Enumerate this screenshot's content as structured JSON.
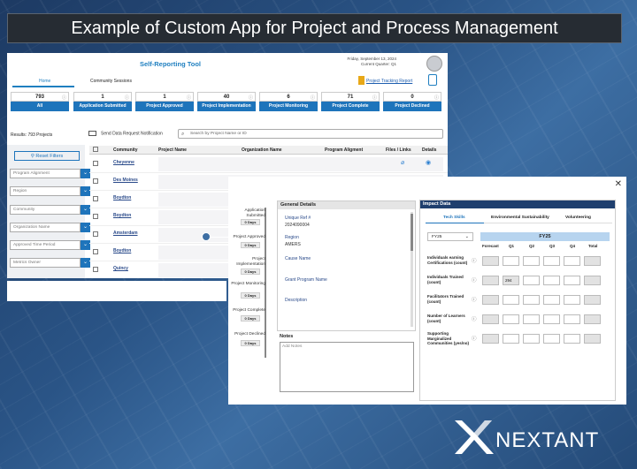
{
  "banner": {
    "title": "Example of Custom App for Project and Process Management"
  },
  "app": {
    "title": "Self-Reporting Tool",
    "date": "Friday, September 13, 2024",
    "quarter": "Current Quarter: Q1",
    "tabs": [
      "Home",
      "Community Sessions"
    ],
    "report_link": "Project Tracking Report"
  },
  "cards": [
    {
      "count": "793",
      "label": "All"
    },
    {
      "count": "1",
      "label": "Application Submitted"
    },
    {
      "count": "1",
      "label": "Project Approved"
    },
    {
      "count": "40",
      "label": "Project Implementation"
    },
    {
      "count": "6",
      "label": "Project Monitoring"
    },
    {
      "count": "71",
      "label": "Project Complete"
    },
    {
      "count": "0",
      "label": "Project Declined"
    }
  ],
  "results": "Results: 793 Projects",
  "send_notification": "Send Data Request Notification",
  "search": {
    "placeholder": "Search by Project Name or ID"
  },
  "reset_filters": "Reset Filters",
  "filters": [
    "Program Alignment",
    "Region",
    "Community",
    "Organization Name",
    "Approved Time Period",
    "Metrics Owner"
  ],
  "table": {
    "columns": [
      "Community",
      "Project Name",
      "Organization Name",
      "Program Aligment",
      "Files / Links",
      "Details"
    ],
    "rows": [
      "Cheyenne",
      "Des Moines",
      "Boydton",
      "Boydton",
      "Amsterdam",
      "Boydton",
      "Quincy"
    ]
  },
  "detail": {
    "steps": [
      {
        "label": "Application Submitted",
        "days": "0 Days"
      },
      {
        "label": "Project Approved",
        "days": "0 Days"
      },
      {
        "label": "Project Implementation",
        "days": "0 Days"
      },
      {
        "label": "Project Monitoring",
        "days": "0 Days"
      },
      {
        "label": "Project Complete",
        "days": "0 Days"
      },
      {
        "label": "Project Declined",
        "days": "0 Days"
      }
    ],
    "general": {
      "title": "General Details",
      "ref_label": "Unique Ref #",
      "ref_value": "2024090004",
      "region_label": "Region",
      "region_value": "AMERS",
      "cause_label": "Cause Name",
      "grant_label": "Grant Program Name",
      "desc_label": "Description"
    },
    "notes": {
      "title": "Notes",
      "placeholder": "Add Notes"
    },
    "impact": {
      "title": "Impact Data",
      "tabs": [
        "Tech Skills",
        "Environmental Sustainability",
        "Volunteering"
      ],
      "fy_select": "FY25",
      "fy_header": "FY25",
      "columns": [
        "Forecast",
        "Q1",
        "Q2",
        "Q3",
        "Q4",
        "Total"
      ],
      "metrics": [
        {
          "label": "Individuals earning Certifications (count)",
          "q1": ""
        },
        {
          "label": "Individuals Trained (count)",
          "q1": "294"
        },
        {
          "label": "Facilitators Trained (count)",
          "q1": ""
        },
        {
          "label": "Number of Learners (count)",
          "q1": ""
        },
        {
          "label": "Supporting Marginalized Communities (yes/no)",
          "q1": ""
        }
      ]
    }
  },
  "logo": {
    "text": "NEXTANT"
  }
}
